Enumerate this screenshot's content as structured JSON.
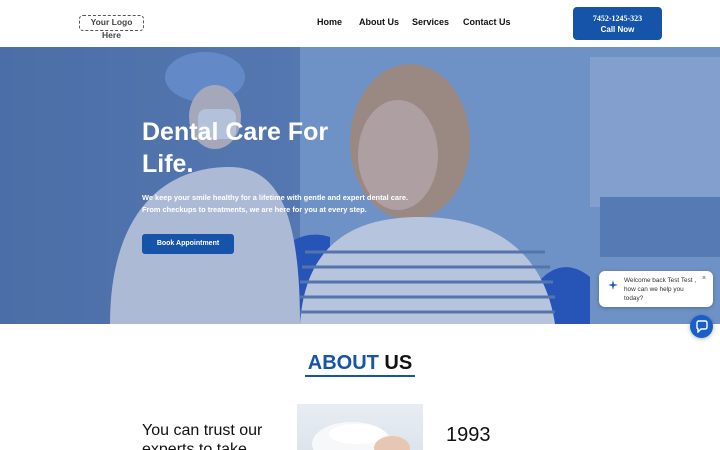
{
  "header": {
    "logo_text": "Your Logo Here",
    "nav": [
      "Home",
      "About Us",
      "Services",
      "Contact Us"
    ],
    "call_phone": "7452-1245-323",
    "call_label": "Call Now"
  },
  "hero": {
    "title": "Dental Care For Life.",
    "text": "We keep your smile healthy for a lifetime with gentle and expert dental care. From checkups to treatments, we are here for you at every step.",
    "cta": "Book Appointment"
  },
  "chat": {
    "message": "Welcome back Test Test , how can we help you today?",
    "close": "×"
  },
  "about": {
    "title_accent": "ABOUT",
    "title_rest": " US",
    "trust": "You can trust our experts to take",
    "year": "1993"
  },
  "colors": {
    "brand": "#1554a8",
    "chat_launcher": "#1a5fc8"
  }
}
